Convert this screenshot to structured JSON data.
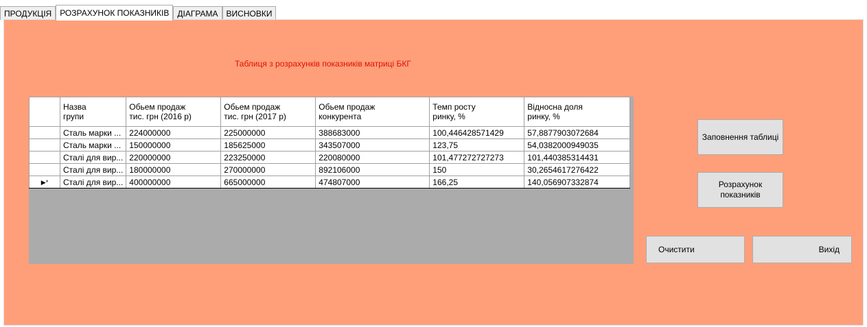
{
  "tabs": [
    "ПРОДУКЦІЯ",
    "РОЗРАХУНОК ПОКАЗНИКІВ",
    "ДІАГРАМА",
    "ВИСНОВКИ"
  ],
  "active_tab": 1,
  "caption": "Таблиця з розрахунків показників матриці БКГ",
  "grid": {
    "columns": [
      {
        "line1": "Назва",
        "line2": "групи"
      },
      {
        "line1": "Обьем продаж",
        "line2": "тис. грн (2016 р)"
      },
      {
        "line1": "Обьем продаж",
        "line2": "тис. грн (2017 р)"
      },
      {
        "line1": "Обьем продаж",
        "line2": "конкурента"
      },
      {
        "line1": "Темп росту",
        "line2": "ринку, %"
      },
      {
        "line1": "Відносна доля",
        "line2": "ринку, %"
      }
    ],
    "rows": [
      [
        "Сталь марки ...",
        "224000000",
        "225000000",
        "388683000",
        "100,446428571429",
        "57,8877903072684"
      ],
      [
        "Сталь марки ...",
        "150000000",
        "185625000",
        "343507000",
        "123,75",
        "54,0382000949035"
      ],
      [
        "Сталі для вир...",
        "220000000",
        "223250000",
        "220080000",
        "101,477272727273",
        "101,440385314431"
      ],
      [
        "Сталі для вир...",
        "180000000",
        "270000000",
        "892106000",
        "150",
        "30,2654617276422"
      ],
      [
        "Сталі для вир...",
        "400000000",
        "665000000",
        "474807000",
        "166,25",
        "140,056907332874"
      ]
    ],
    "current_row_marker": "▶*"
  },
  "buttons": {
    "fill": "Заповнення таблиці",
    "calc": "Розрахунок показників",
    "clear": "Очистити",
    "exit": "Вихід"
  }
}
